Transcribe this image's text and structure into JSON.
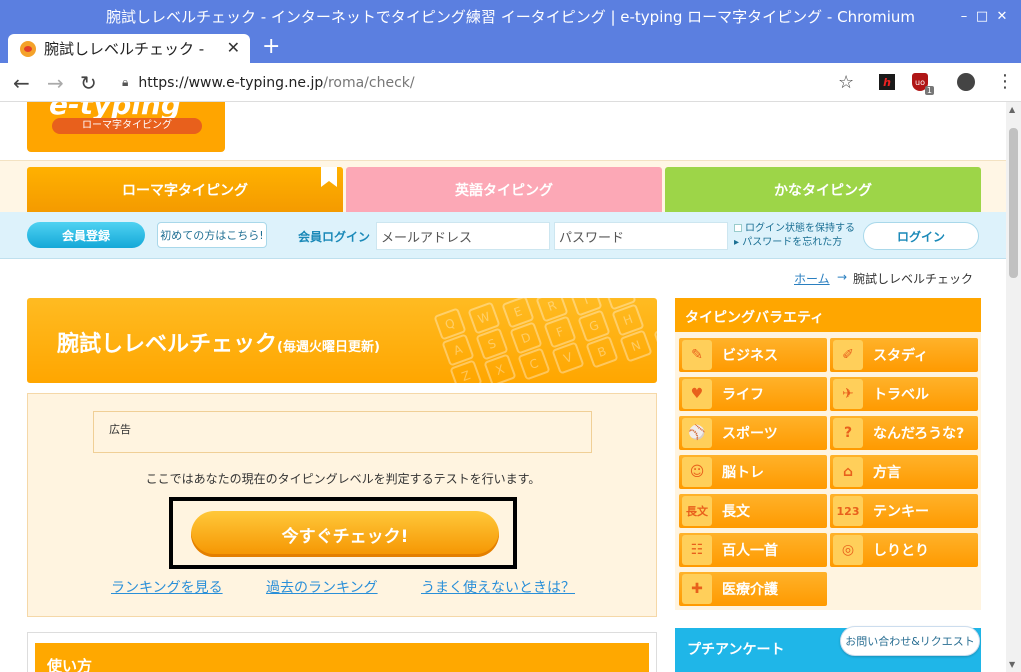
{
  "browser": {
    "window_title": "腕試しレベルチェック - インターネットでタイピング練習 イータイピング | e-typing ローマ字タイピング - Chromium",
    "tab_title": "腕試しレベルチェック -",
    "url_main": "https://www.e-typing.ne.jp",
    "url_path": "/roma/check/",
    "ext_badge": "1"
  },
  "logo": {
    "name": "e-typing",
    "sub": "ローマ字タイピング"
  },
  "nav": {
    "roma": "ローマ字タイピング",
    "english": "英語タイピング",
    "kana": "かなタイピング"
  },
  "login": {
    "register": "会員登録",
    "first_time": "初めての方はこちら!",
    "member_login_label": "会員ログイン",
    "email_placeholder": "メールアドレス",
    "password_placeholder": "パスワード",
    "keep_login": "ログイン状態を保持する",
    "forgot_password": "パスワードを忘れた方",
    "login_button": "ログイン"
  },
  "breadcrumb": {
    "home": "ホーム",
    "arrow": "→",
    "current": "腕試しレベルチェック"
  },
  "main": {
    "title": "腕試しレベルチェック",
    "title_small": "(毎週火曜日更新)",
    "keys": [
      "Q",
      "W",
      "E",
      "R",
      "T",
      "Y",
      "A",
      "S",
      "D",
      "F",
      "G",
      "H",
      "Z",
      "X",
      "C",
      "V",
      "B",
      "N",
      "M"
    ],
    "ad_label": "広告",
    "description": "ここではあなたの現在のタイピングレベルを判定するテストを行います。",
    "check_button": "今すぐチェック!",
    "link_ranking": "ランキングを見る",
    "link_past_ranking": "過去のランキング",
    "link_help": "うまく使えないときは？",
    "usage_title": "使い方"
  },
  "sidebar": {
    "variety_title": "タイピングバラエティ",
    "items": [
      {
        "label": "ビジネス",
        "icon": "necktie-icon",
        "glyph": "✎"
      },
      {
        "label": "スタディ",
        "icon": "notebook-icon",
        "glyph": "✐"
      },
      {
        "label": "ライフ",
        "icon": "heart-icon",
        "glyph": "♥"
      },
      {
        "label": "トラベル",
        "icon": "airplane-icon",
        "glyph": "✈"
      },
      {
        "label": "スポーツ",
        "icon": "ball-icon",
        "glyph": "⚾"
      },
      {
        "label": "なんだろうな?",
        "icon": "question-icon",
        "glyph": "?"
      },
      {
        "label": "脳トレ",
        "icon": "brain-icon",
        "glyph": "☺"
      },
      {
        "label": "方言",
        "icon": "japan-map-icon",
        "glyph": "⌂"
      },
      {
        "label": "長文",
        "icon": "long-text-icon",
        "glyph": "長文"
      },
      {
        "label": "テンキー",
        "icon": "tenkey-icon",
        "glyph": "123"
      },
      {
        "label": "百人一首",
        "icon": "karuta-icon",
        "glyph": "☷"
      },
      {
        "label": "しりとり",
        "icon": "shiritori-icon",
        "glyph": "◎"
      },
      {
        "label": "医療介護",
        "icon": "syringe-icon",
        "glyph": "✚"
      }
    ],
    "survey_title": "プチアンケート",
    "contact": "お問い合わせ&リクエスト"
  }
}
